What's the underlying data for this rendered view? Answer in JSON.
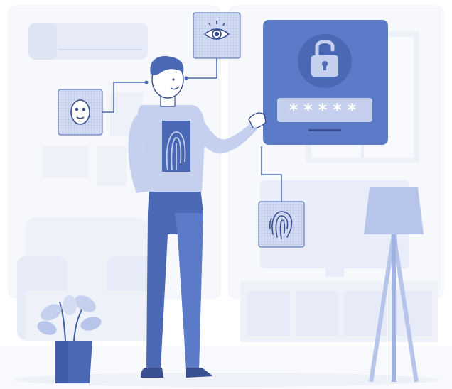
{
  "illustration": {
    "password_mask": "*****",
    "colors": {
      "primary": "#5b7bc8",
      "primary_dark": "#3f5ea8",
      "light": "#c4d0ee",
      "pale": "#e8edf9",
      "very_pale": "#f3f5fb",
      "skin": "#ffffff",
      "outline": "#3a4f8f"
    },
    "icons": [
      "padlock-icon",
      "eye-icon",
      "face-id-icon",
      "fingerprint-icon"
    ]
  }
}
